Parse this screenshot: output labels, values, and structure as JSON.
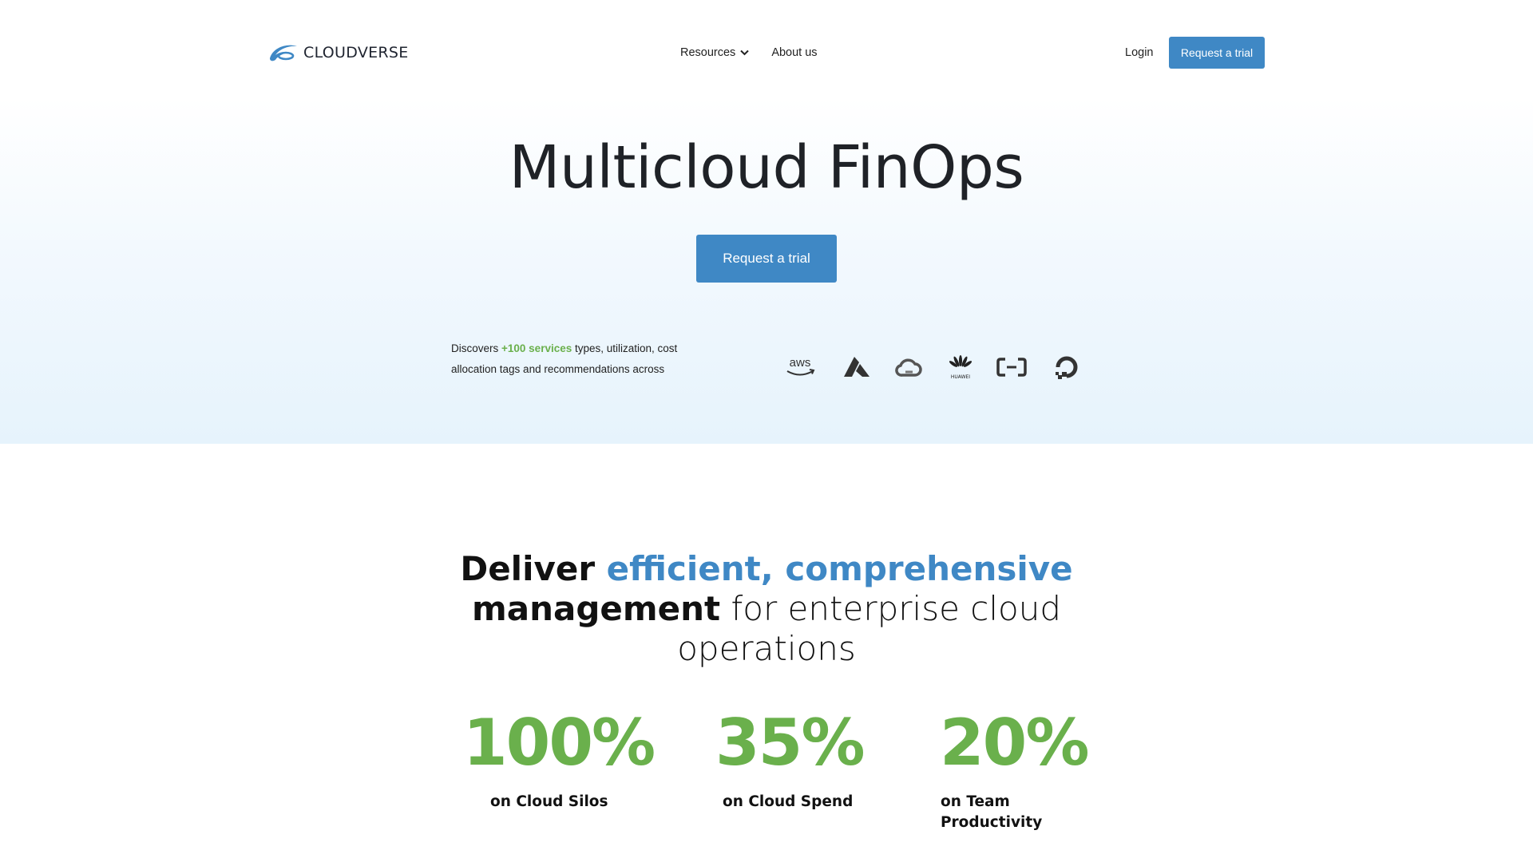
{
  "nav": {
    "logo_text": "CLOUDVERSE",
    "resources": "Resources",
    "about": "About us",
    "login": "Login",
    "cta": "Request a trial"
  },
  "hero": {
    "title": "Multicloud FinOps",
    "cta": "Request a trial",
    "discover_prefix": "Discovers ",
    "discover_highlight": "+100 services",
    "discover_suffix": " types, utilization, cost allocation tags and recommendations across",
    "providers": [
      {
        "name": "aws",
        "label": "aws",
        "icon": "aws-icon"
      },
      {
        "name": "azure",
        "label": "",
        "icon": "azure-icon"
      },
      {
        "name": "google-cloud",
        "label": "",
        "icon": "google-cloud-icon"
      },
      {
        "name": "huawei",
        "label": "HUAWEI",
        "icon": "huawei-icon"
      },
      {
        "name": "alibaba",
        "label": "",
        "icon": "alibaba-cloud-icon"
      },
      {
        "name": "digitalocean",
        "label": "",
        "icon": "digitalocean-icon"
      }
    ]
  },
  "deliver": {
    "part1": "Deliver ",
    "part2": "efficient, comprehensive",
    "part3": "management",
    "part4": " for enterprise cloud operations"
  },
  "stats": [
    {
      "value": "100%",
      "label": "on Cloud Silos"
    },
    {
      "value": "35%",
      "label": "on Cloud Spend"
    },
    {
      "value": "20%",
      "label": "on Team Productivity"
    }
  ],
  "colors": {
    "brand_blue": "#3f88c5",
    "accent_green": "#6ab04c",
    "text_dark": "#1f2227"
  }
}
